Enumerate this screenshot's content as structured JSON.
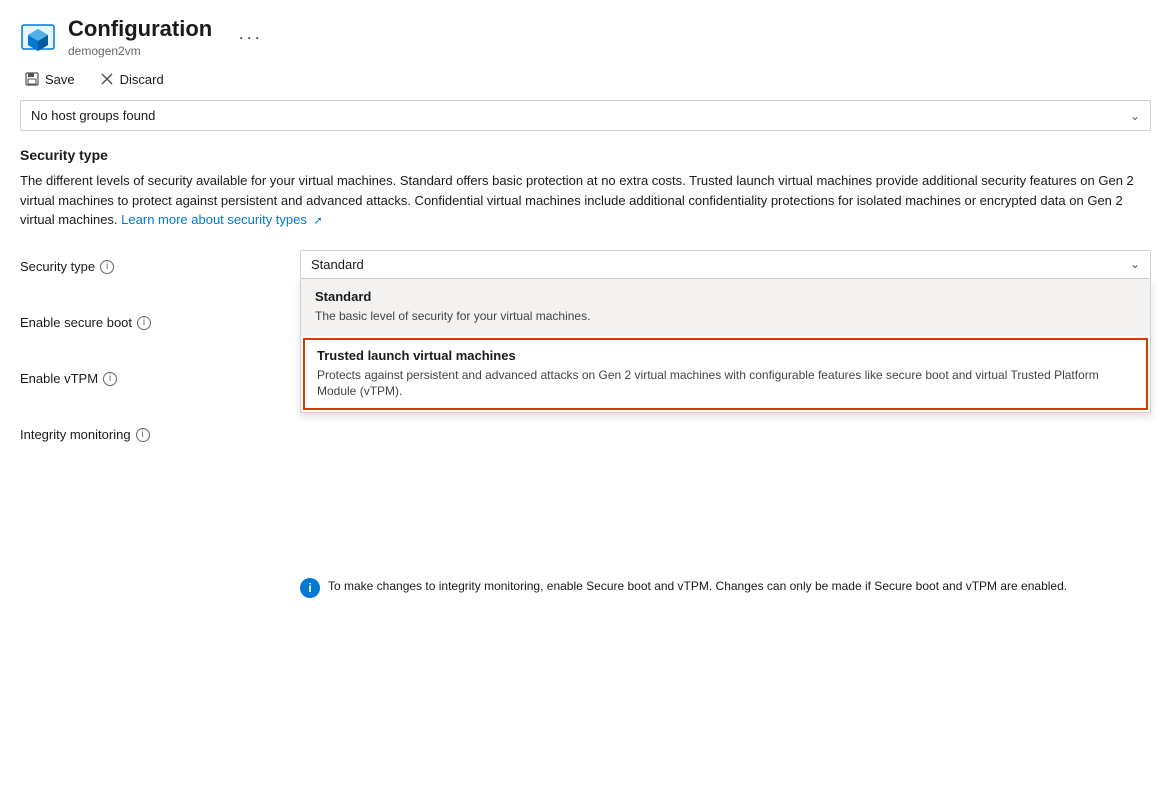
{
  "header": {
    "title": "Configuration",
    "subtitle": "demogen2vm",
    "more_label": "···"
  },
  "toolbar": {
    "save_label": "Save",
    "discard_label": "Discard"
  },
  "host_group": {
    "placeholder": "No host groups found"
  },
  "security": {
    "section_title": "Security type",
    "section_desc_part1": "The different levels of security available for your virtual machines. Standard offers basic protection at no extra costs. Trusted launch virtual machines provide additional security features on Gen 2 virtual machines to protect against persistent and advanced attacks. Confidential virtual machines include additional confidentiality protections for isolated machines or encrypted data on Gen 2 virtual machines.",
    "section_desc_link": "Learn more about security types",
    "fields": [
      {
        "label": "Security type",
        "info": true
      },
      {
        "label": "Enable secure boot",
        "info": true
      },
      {
        "label": "Enable vTPM",
        "info": true
      },
      {
        "label": "Integrity monitoring",
        "info": true
      }
    ],
    "dropdown_current": "Standard",
    "dropdown_items": [
      {
        "id": "standard",
        "title": "Standard",
        "desc": "The basic level of security for your virtual machines.",
        "selected": true,
        "highlighted": false
      },
      {
        "id": "trusted",
        "title": "Trusted launch virtual machines",
        "desc": "Protects against persistent and advanced attacks on Gen 2 virtual machines with configurable features like secure boot and virtual Trusted Platform Module (vTPM).",
        "selected": false,
        "highlighted": true
      }
    ],
    "info_notice": "To make changes to integrity monitoring, enable Secure boot and vTPM. Changes can only be made if Secure boot and vTPM are enabled."
  }
}
